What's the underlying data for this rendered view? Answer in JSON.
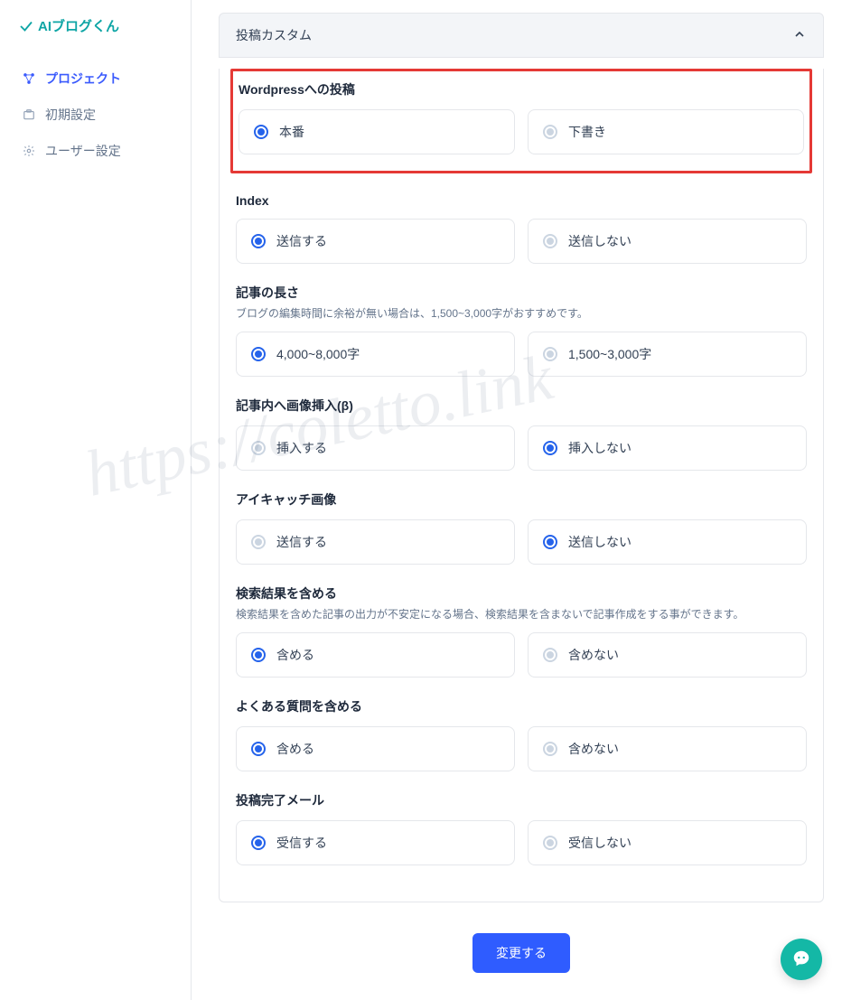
{
  "brand": "AIブログくん",
  "watermark": "https://coletto.link",
  "sidebar": {
    "items": [
      {
        "label": "プロジェクト",
        "active": true
      },
      {
        "label": "初期設定",
        "active": false
      },
      {
        "label": "ユーザー設定",
        "active": false
      }
    ]
  },
  "accordion_title": "投稿カスタム",
  "sections": [
    {
      "key": "wordpress",
      "title": "Wordpressへの投稿",
      "highlight": true,
      "options": [
        {
          "label": "本番",
          "selected": true
        },
        {
          "label": "下書き",
          "selected": false
        }
      ]
    },
    {
      "key": "index",
      "title": "Index",
      "options": [
        {
          "label": "送信する",
          "selected": true
        },
        {
          "label": "送信しない",
          "selected": false
        }
      ]
    },
    {
      "key": "length",
      "title": "記事の長さ",
      "subtitle": "ブログの編集時間に余裕が無い場合は、1,500~3,000字がおすすめです。",
      "options": [
        {
          "label": "4,000~8,000字",
          "selected": true
        },
        {
          "label": "1,500~3,000字",
          "selected": false
        }
      ]
    },
    {
      "key": "image_insert",
      "title": "記事内へ画像挿入(β)",
      "options": [
        {
          "label": "挿入する",
          "selected": false
        },
        {
          "label": "挿入しない",
          "selected": true
        }
      ]
    },
    {
      "key": "eyecatch",
      "title": "アイキャッチ画像",
      "options": [
        {
          "label": "送信する",
          "selected": false
        },
        {
          "label": "送信しない",
          "selected": true
        }
      ]
    },
    {
      "key": "search_results",
      "title": "検索結果を含める",
      "subtitle": "検索結果を含めた記事の出力が不安定になる場合、検索結果を含まないで記事作成をする事ができます。",
      "options": [
        {
          "label": "含める",
          "selected": true
        },
        {
          "label": "含めない",
          "selected": false
        }
      ]
    },
    {
      "key": "faq",
      "title": "よくある質問を含める",
      "options": [
        {
          "label": "含める",
          "selected": true
        },
        {
          "label": "含めない",
          "selected": false
        }
      ]
    },
    {
      "key": "completion_mail",
      "title": "投稿完了メール",
      "options": [
        {
          "label": "受信する",
          "selected": true
        },
        {
          "label": "受信しない",
          "selected": false
        }
      ]
    }
  ],
  "submit_label": "変更する"
}
